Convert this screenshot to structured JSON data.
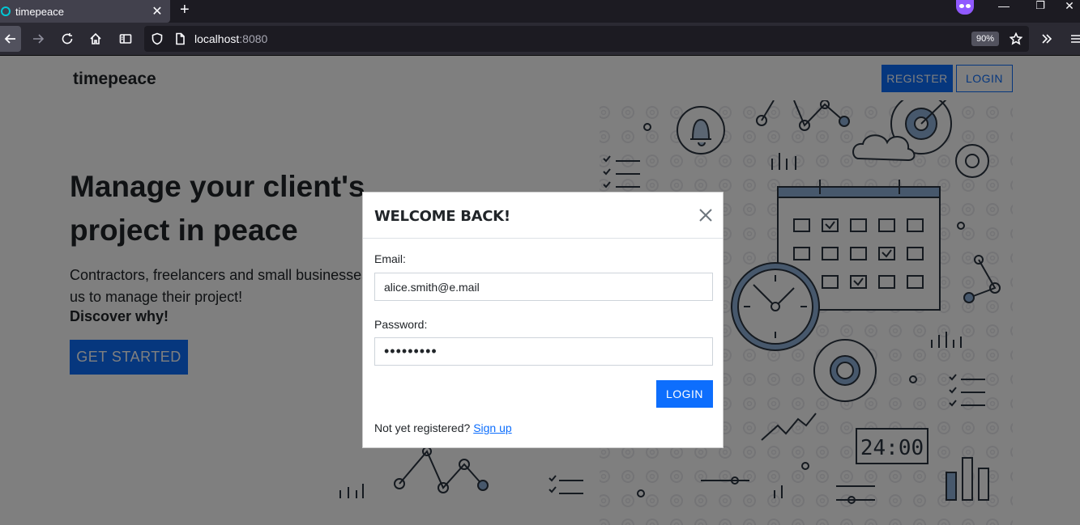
{
  "browser": {
    "tab_title": "timepeace",
    "url_host": "localhost",
    "url_port": ":8080",
    "zoom": "90%"
  },
  "page": {
    "brand": "timepeace",
    "nav": {
      "register": "REGISTER",
      "login": "LOGIN"
    },
    "hero": {
      "title": "Manage your client's project in peace",
      "description": "Contractors, freelancers and small businesses us to manage their project!",
      "emphasis": "Discover why!",
      "cta": "GET STARTED"
    },
    "illustration_clock": "24:00"
  },
  "modal": {
    "title": "WELCOME BACK!",
    "email_label": "Email:",
    "email_value": "alice.smith@e.mail",
    "password_label": "Password:",
    "password_value": "•••••••••",
    "login_button": "LOGIN",
    "signup_prompt": "Not yet registered?",
    "signup_link": "Sign up"
  }
}
